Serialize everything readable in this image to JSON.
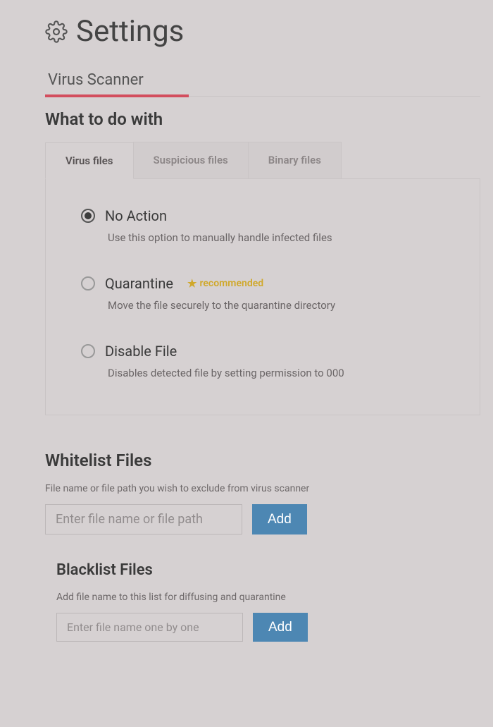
{
  "page": {
    "title": "Settings"
  },
  "main_tab": {
    "label": "Virus Scanner",
    "active": true
  },
  "what_to_do": {
    "heading": "What to do with",
    "tabs": [
      {
        "label": "Virus files",
        "active": true
      },
      {
        "label": "Suspicious files",
        "active": false
      },
      {
        "label": "Binary files",
        "active": false
      }
    ],
    "options": [
      {
        "id": "no-action",
        "label": "No Action",
        "description": "Use this option to manually handle infected files",
        "selected": true,
        "recommended": false
      },
      {
        "id": "quarantine",
        "label": "Quarantine",
        "description": "Move the file securely to the quarantine directory",
        "selected": false,
        "recommended": true,
        "recommended_label": "recommended"
      },
      {
        "id": "disable-file",
        "label": "Disable File",
        "description": "Disables detected file by setting permission to 000",
        "selected": false,
        "recommended": false
      }
    ]
  },
  "whitelist": {
    "heading": "Whitelist Files",
    "help": "File name or file path you wish to exclude from virus scanner",
    "placeholder": "Enter file name or file path",
    "button": "Add"
  },
  "blacklist": {
    "heading": "Blacklist Files",
    "help": "Add file name to this list for diffusing and quarantine",
    "placeholder": "Enter file name one by one",
    "button": "Add"
  }
}
